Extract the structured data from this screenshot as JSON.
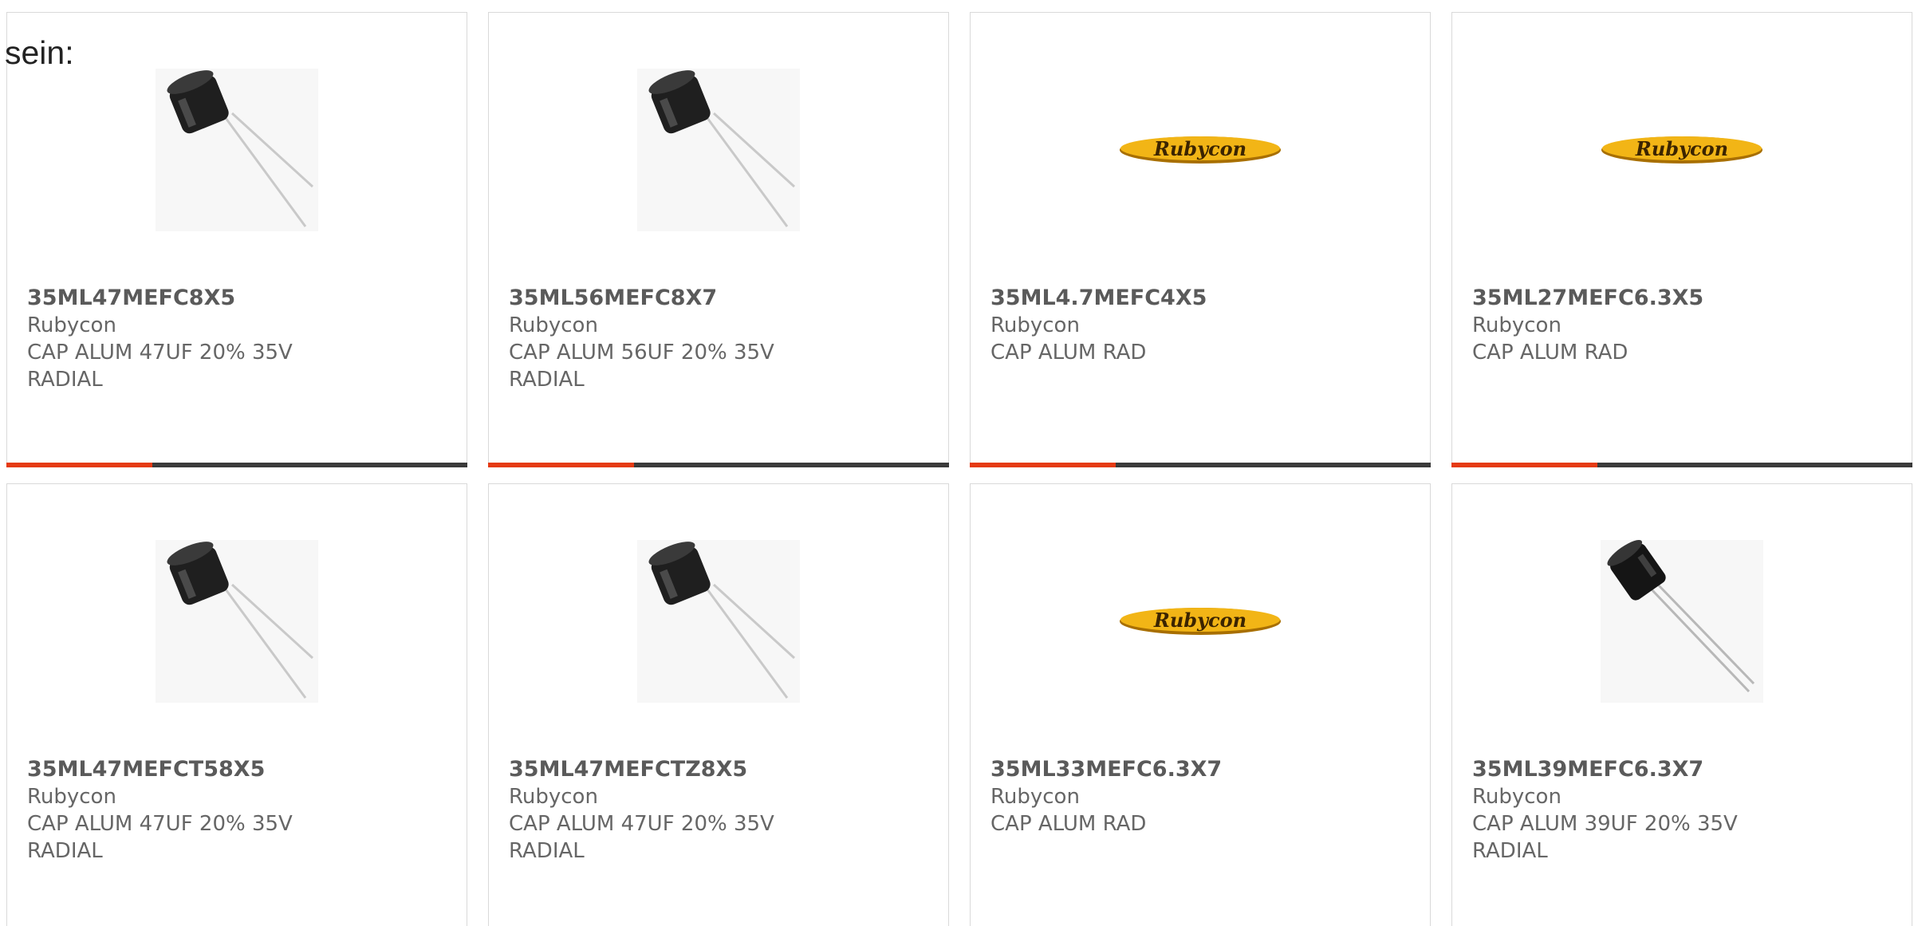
{
  "lead_text": "sein:",
  "colors": {
    "accent": "#e53a12",
    "bar": "#3a3a3a",
    "border": "#d9d9d9",
    "logo_yellow": "#f2b516",
    "logo_text": "#3b2400"
  },
  "products": [
    {
      "part": "35ML47MEFC8X5",
      "maker": "Rubycon",
      "desc": "CAP ALUM 47UF 20% 35V RADIAL",
      "image": "capacitor-photo"
    },
    {
      "part": "35ML56MEFC8X7",
      "maker": "Rubycon",
      "desc": "CAP ALUM 56UF 20% 35V RADIAL",
      "image": "capacitor-photo"
    },
    {
      "part": "35ML4.7MEFC4X5",
      "maker": "Rubycon",
      "desc": "CAP ALUM RAD",
      "image": "rubycon-logo",
      "logo_text": "Rubycon"
    },
    {
      "part": "35ML27MEFC6.3X5",
      "maker": "Rubycon",
      "desc": "CAP ALUM RAD",
      "image": "rubycon-logo",
      "logo_text": "Rubycon"
    },
    {
      "part": "35ML47MEFCT58X5",
      "maker": "Rubycon",
      "desc": "CAP ALUM 47UF 20% 35V RADIAL",
      "image": "capacitor-photo"
    },
    {
      "part": "35ML47MEFCTZ8X5",
      "maker": "Rubycon",
      "desc": "CAP ALUM 47UF 20% 35V RADIAL",
      "image": "capacitor-photo"
    },
    {
      "part": "35ML33MEFC6.3X7",
      "maker": "Rubycon",
      "desc": "CAP ALUM RAD",
      "image": "rubycon-logo",
      "logo_text": "Rubycon"
    },
    {
      "part": "35ML39MEFC6.3X7",
      "maker": "Rubycon",
      "desc": "CAP ALUM 39UF 20% 35V RADIAL",
      "image": "capacitor-photo-slim"
    }
  ]
}
